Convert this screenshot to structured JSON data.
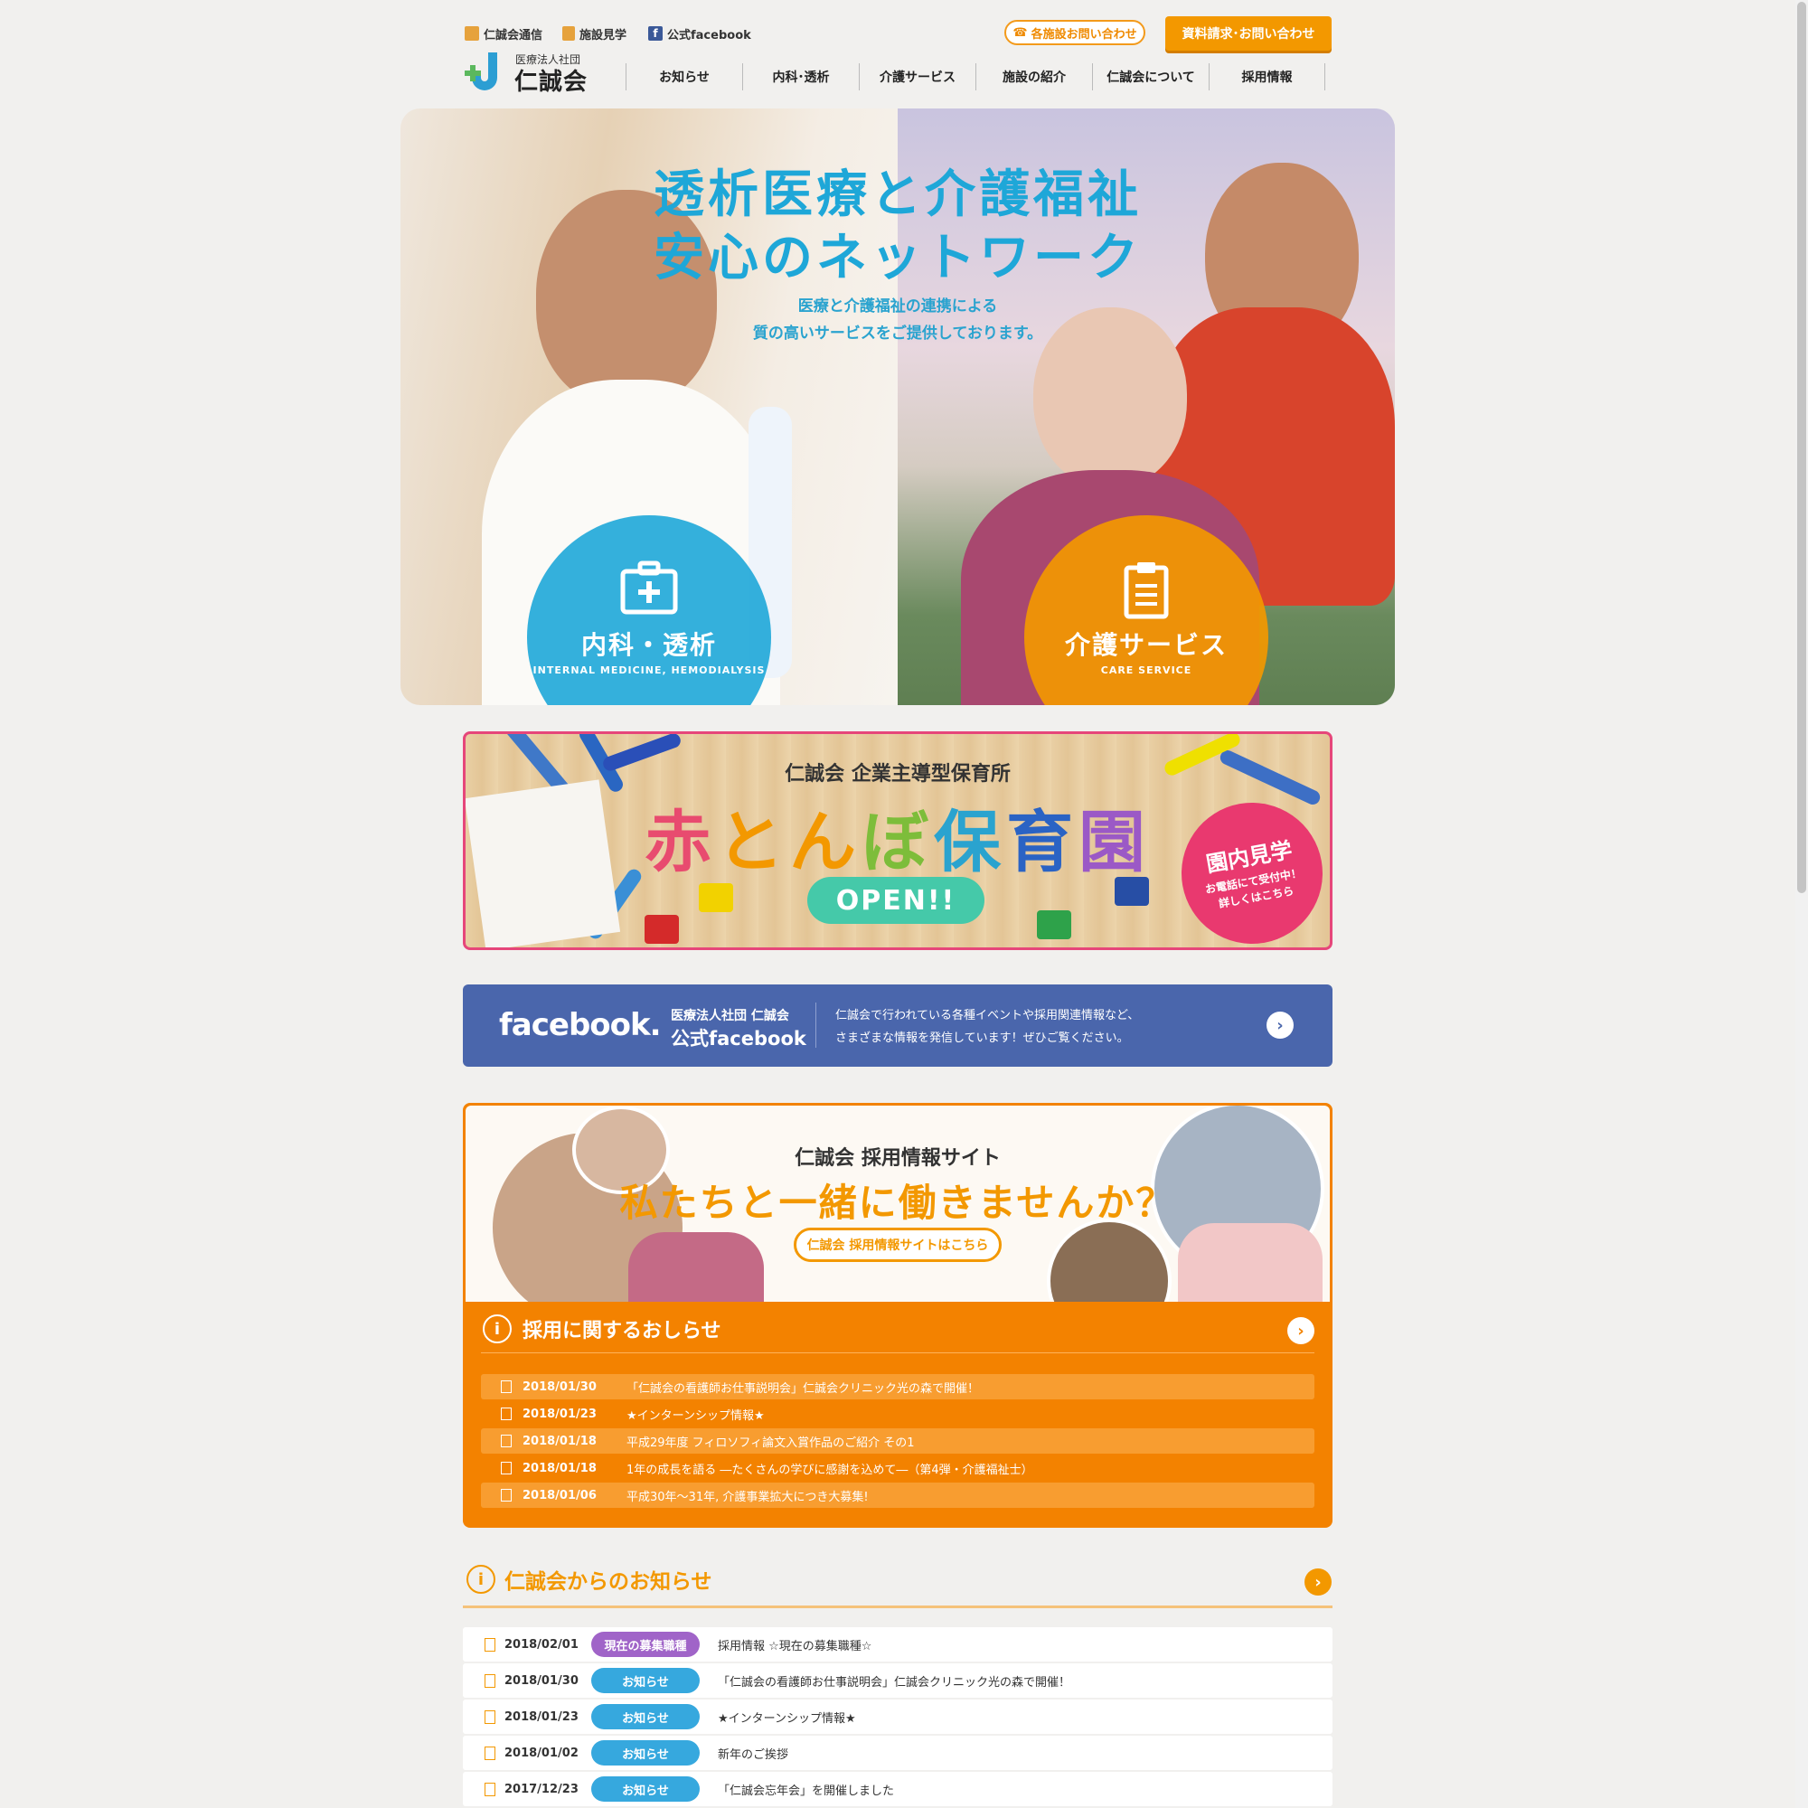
{
  "top_links": [
    {
      "label": "仁誠会通信",
      "icon": "book-icon",
      "color": "#e6a23c"
    },
    {
      "label": "施設見学",
      "icon": "sign-icon",
      "color": "#e6a23c"
    },
    {
      "label": "公式facebook",
      "icon": "facebook-icon",
      "color": "#3b5998"
    }
  ],
  "header": {
    "phone_button": "各施設お問い合わせ",
    "request_button": "資料請求･お問い合わせ",
    "logo_sub": "医療法人社団",
    "logo_main": "仁誠会"
  },
  "nav": [
    "お知らせ",
    "内科･透析",
    "介護サービス",
    "施設の紹介",
    "仁誠会について",
    "採用情報"
  ],
  "hero": {
    "title_line1": "透析医療と介護福祉",
    "title_line2": "安心のネットワーク",
    "sub_line1": "医療と介護福祉の連携による",
    "sub_line2": "質の高いサービスをご提供しております。",
    "left_button": {
      "label": "内科・透析",
      "en": "INTERNAL MEDICINE, HEMODIALYSIS",
      "icon": "medical-bag-icon",
      "color": "#1ea7d8"
    },
    "right_button": {
      "label": "介護サービス",
      "en": "CARE SERVICE",
      "icon": "clipboard-icon",
      "color": "#f39800"
    }
  },
  "nursery": {
    "subtitle": "仁誠会 企業主導型保育所",
    "title": "赤とんぼ保育園",
    "open": "OPEN!!",
    "badge_title": "園内見学",
    "badge_line1": "お電話にて受付中！",
    "badge_line2": "詳しくはこちら",
    "title_colors": [
      "#e84b6f",
      "#f39800",
      "#f39800",
      "#7dbd3a",
      "#2aa3cf",
      "#2a63c4",
      "#9b59c6"
    ]
  },
  "facebook_banner": {
    "logo": "facebook.",
    "org": "医療法人社団 仁誠会",
    "name": "公式facebook",
    "desc1": "仁誠会で行われている各種イベントや採用関連情報など、",
    "desc2": "さまざまな情報を発信しています！ぜひご覧ください。"
  },
  "recruit": {
    "subtitle": "仁誠会 採用情報サイト",
    "title": "私たちと一緒に働きませんか？",
    "button": "仁誠会 採用情報サイトはこちら",
    "heading": "採用に関するおしらせ",
    "items": [
      {
        "date": "2018/01/30",
        "text": "「仁誠会の看護師お仕事説明会」仁誠会クリニック光の森で開催！"
      },
      {
        "date": "2018/01/23",
        "text": "★インターンシップ情報★"
      },
      {
        "date": "2018/01/18",
        "text": "平成29年度 フィロソフィ論文入賞作品のご紹介 その1"
      },
      {
        "date": "2018/01/18",
        "text": "1年の成長を語る ―たくさんの学びに感謝を込めて―（第4弾・介護福祉士）"
      },
      {
        "date": "2018/01/06",
        "text": "平成30年～31年, 介護事業拡大につき大募集!"
      }
    ]
  },
  "news": {
    "heading": "仁誠会からのお知らせ",
    "items": [
      {
        "date": "2018/02/01",
        "tag": "現在の募集職種",
        "tag_color": "#a064c8",
        "text": "採用情報 ☆現在の募集職種☆"
      },
      {
        "date": "2018/01/30",
        "tag": "お知らせ",
        "tag_color": "#36a8de",
        "text": "「仁誠会の看護師お仕事説明会」仁誠会クリニック光の森で開催！"
      },
      {
        "date": "2018/01/23",
        "tag": "お知らせ",
        "tag_color": "#36a8de",
        "text": "★インターンシップ情報★"
      },
      {
        "date": "2018/01/02",
        "tag": "お知らせ",
        "tag_color": "#36a8de",
        "text": "新年のご挨拶"
      },
      {
        "date": "2017/12/23",
        "tag": "お知らせ",
        "tag_color": "#36a8de",
        "text": "「仁誠会忘年会」を開催しました"
      }
    ]
  }
}
